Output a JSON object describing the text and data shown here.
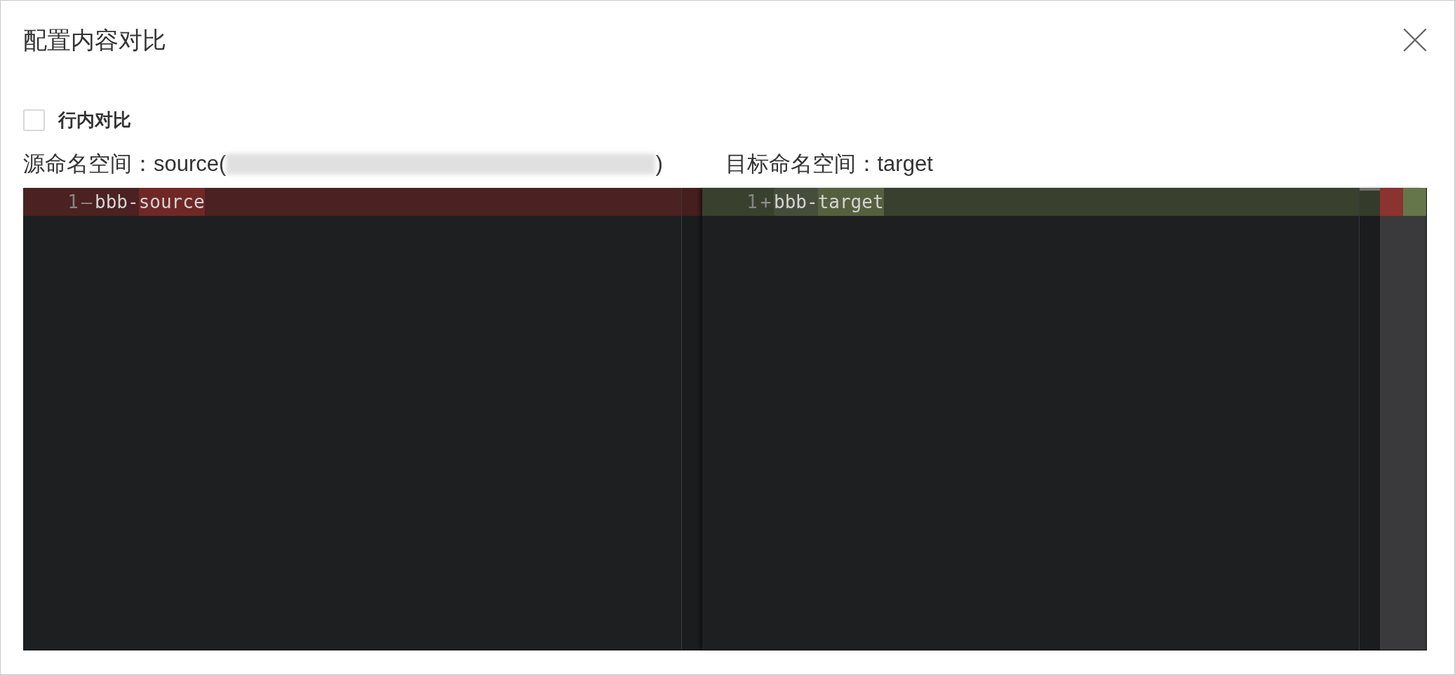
{
  "dialog": {
    "title": "配置内容对比"
  },
  "inline_diff_toggle": {
    "label": "行内对比",
    "checked": false
  },
  "namespaces": {
    "source": {
      "text": "源命名空间：source(",
      "redacted": true,
      "text_after": ")"
    },
    "target": {
      "text": "目标命名空间：target"
    }
  },
  "diff_editor": {
    "original": {
      "lines": [
        {
          "number": "1",
          "sign": "—",
          "kind": "deleted",
          "segments": [
            {
              "text": "bbb-",
              "kind": "plain"
            },
            {
              "text": "source",
              "kind": "changed"
            }
          ]
        }
      ]
    },
    "modified": {
      "lines": [
        {
          "number": "1",
          "sign": "+",
          "kind": "inserted",
          "segments": [
            {
              "text": "bbb-",
              "kind": "matched"
            },
            {
              "text": "target",
              "kind": "changed"
            }
          ]
        }
      ]
    },
    "overview_marks": [
      {
        "kind": "deleted"
      },
      {
        "kind": "inserted"
      }
    ]
  }
}
